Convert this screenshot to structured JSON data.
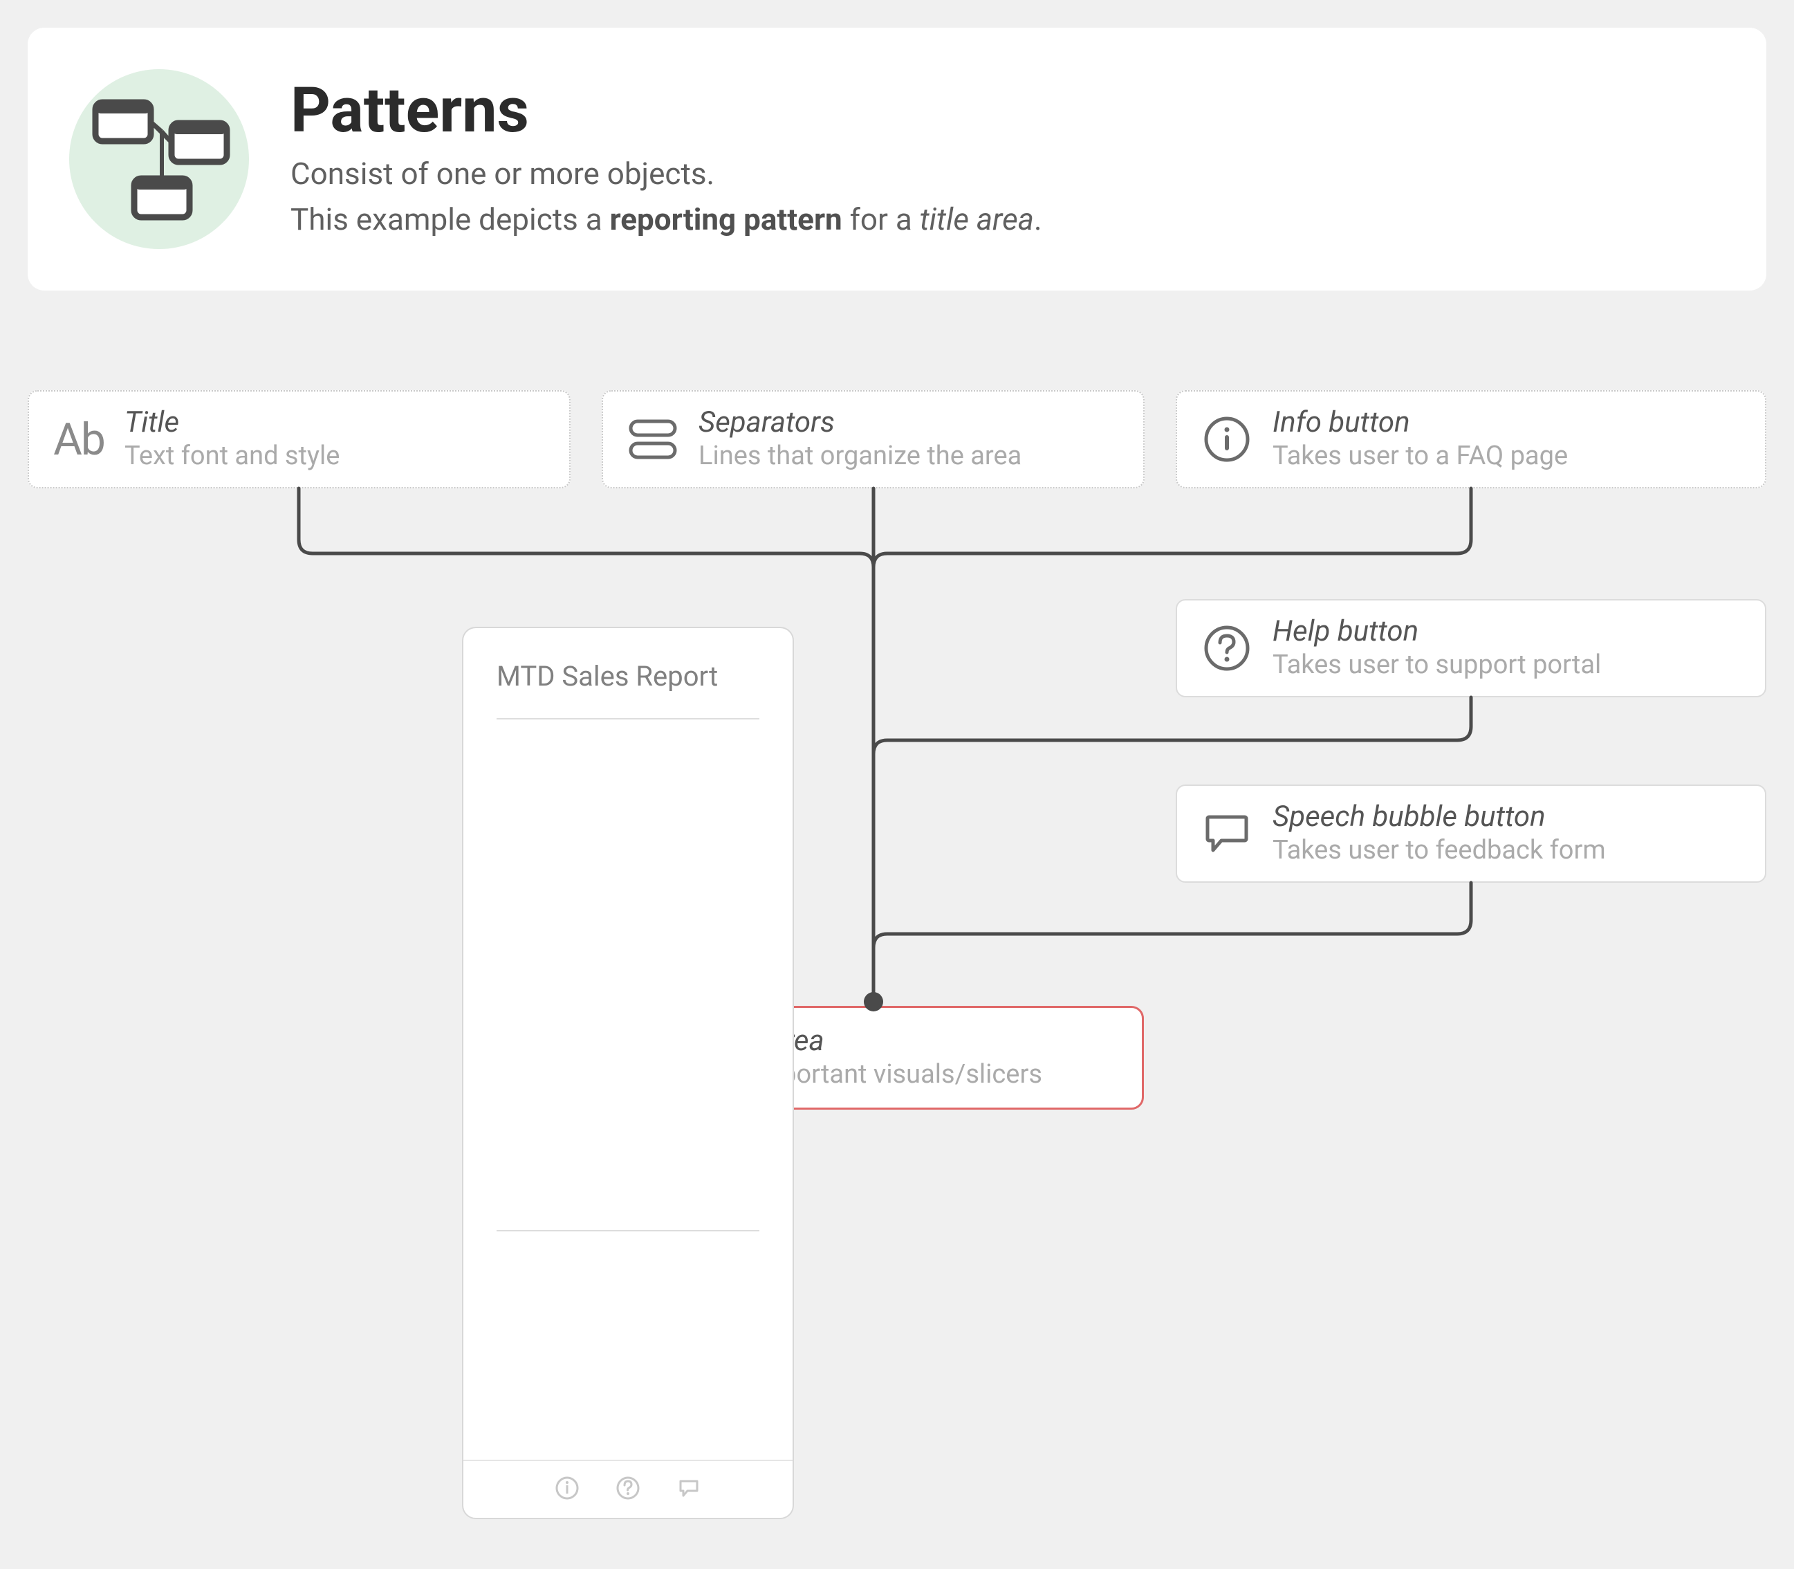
{
  "header": {
    "title": "Patterns",
    "subtitle1": "Consist of one or more objects.",
    "subtitle2_pre": "This example depicts a ",
    "subtitle2_bold": "reporting pattern",
    "subtitle2_mid": " for a ",
    "subtitle2_italic": "title area",
    "subtitle2_post": "."
  },
  "objects": {
    "title": {
      "label": "Title",
      "desc": "Text font and style",
      "icon_text": "Ab"
    },
    "separators": {
      "label": "Separators",
      "desc": "Lines that organize the area"
    },
    "info": {
      "label": "Info button",
      "desc": "Takes user to a FAQ page"
    },
    "help": {
      "label": "Help button",
      "desc": "Takes user to support portal"
    },
    "speech": {
      "label": "Speech bubble button",
      "desc": "Takes user to feedback form"
    }
  },
  "destination": {
    "label": "Title area",
    "desc": "For important visuals/slicers"
  },
  "report": {
    "title": "MTD Sales Report"
  }
}
